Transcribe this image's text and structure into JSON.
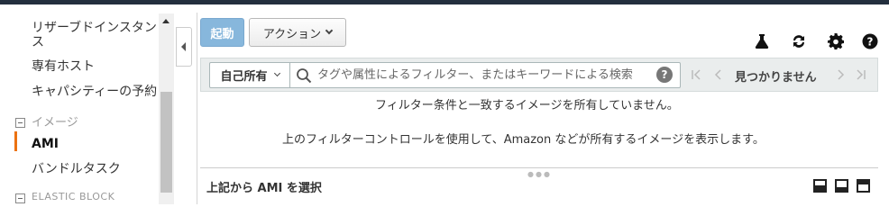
{
  "sidebar": {
    "items": [
      {
        "label": "リザーブドインスタン"
      },
      {
        "label": "ス"
      },
      {
        "label": "専有ホスト"
      },
      {
        "label": "キャパシティーの予約"
      }
    ],
    "group_images": "イメージ",
    "images_items": [
      {
        "label": "AMI",
        "active": true
      },
      {
        "label": "バンドルタスク"
      }
    ],
    "group_ebs": "ELASTIC BLOCK"
  },
  "toolbar": {
    "launch_label": "起動",
    "actions_label": "アクション",
    "icons": [
      "flask-icon",
      "refresh-icon",
      "gear-icon",
      "help-icon"
    ]
  },
  "filter": {
    "owner_label": "自己所有",
    "search_placeholder": "タグや属性によるフィルター、またはキーワードによる検索",
    "help_label": "?",
    "pager_status": "見つかりません"
  },
  "content": {
    "empty_message_1": "フィルター条件と一致するイメージを所有していません。",
    "empty_message_2": "上のフィルターコントロールを使用して、Amazon などが所有するイメージを表示します。"
  },
  "detail": {
    "title": "上記から AMI を選択"
  },
  "colors": {
    "accent": "#ec7211",
    "launch_button": "#87b7dc",
    "top_bar": "#232f3e"
  }
}
